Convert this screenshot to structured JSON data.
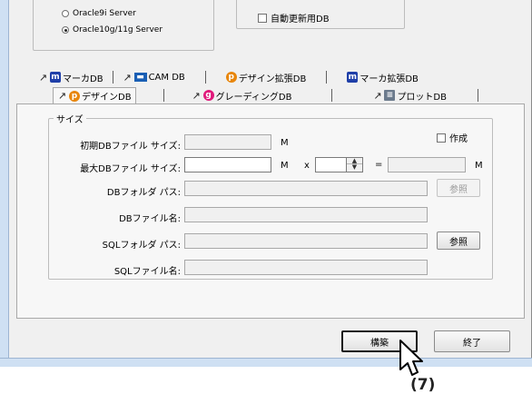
{
  "db_options": {
    "oracle9i_label": "Oracle9i Server",
    "oracle10g_label": "Oracle10g/11g Server",
    "auto_update_label": "自動更新用DB"
  },
  "tabs": {
    "row1": [
      {
        "label": "マーカDB",
        "icon": "marker-icon"
      },
      {
        "label": "CAM DB",
        "icon": "cam-icon"
      },
      {
        "label": "デザイン拡張DB",
        "icon": "design-icon"
      },
      {
        "label": "マーカ拡張DB",
        "icon": "marker-icon"
      }
    ],
    "row2": [
      {
        "label": "デザインDB",
        "icon": "design-icon",
        "active": true
      },
      {
        "label": "グレーディングDB",
        "icon": "grading-icon"
      },
      {
        "label": "プロットDB",
        "icon": "plot-icon"
      }
    ]
  },
  "size_group": {
    "legend": "サイズ",
    "initial_size_label": "初期DBファイル サイズ:",
    "initial_size_unit": "M",
    "max_size_label": "最大DBファイル サイズ:",
    "max_size_unit": "M",
    "multiply": "x",
    "equals": "=",
    "result_unit": "M",
    "create_label": "作成",
    "db_folder_label": "DBフォルダ パス:",
    "db_file_label": "DBファイル名:",
    "sql_folder_label": "SQLフォルダ パス:",
    "sql_file_label": "SQLファイル名:",
    "browse_label": "参照",
    "browse_sql_label": "参照"
  },
  "footer": {
    "build_label": "構築",
    "exit_label": "終了"
  },
  "annotation": {
    "step": "(7)"
  },
  "colors": {
    "window_bg": "#f0f0f0",
    "frame": "#cfe0f3",
    "marker_icon": "#1f3fa8",
    "design_icon": "#e8860c",
    "grading_icon": "#e0197b",
    "cam_icon": "#1a5fb4"
  }
}
